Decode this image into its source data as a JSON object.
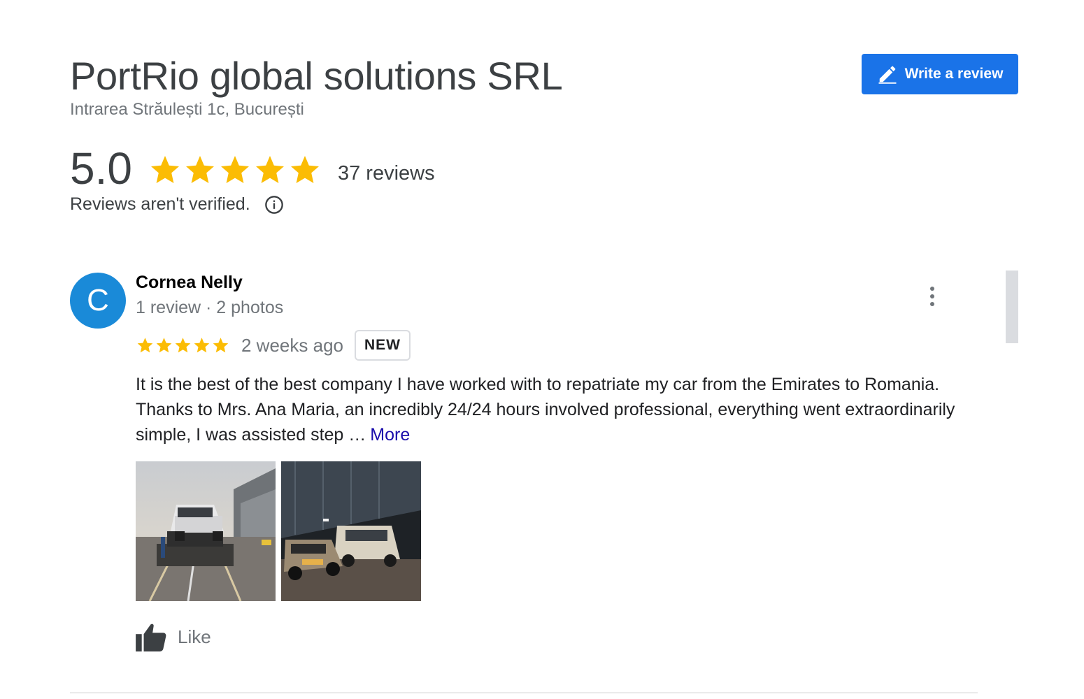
{
  "business": {
    "name": "PortRio global solutions SRL",
    "address": "Intrarea Străulești 1c, București"
  },
  "write_review": {
    "label": "Write a review",
    "icon": "pencil-icon",
    "color": "#1a73e8"
  },
  "rating": {
    "score": "5.0",
    "stars": 5,
    "review_count": "37 reviews",
    "verified_note": "Reviews aren't verified.",
    "star_color": "#fbbc04"
  },
  "review": {
    "avatar_letter": "C",
    "avatar_color": "#1a8ad8",
    "author": "Cornea Nelly",
    "meta": "1 review · 2 photos",
    "stars": 5,
    "time": "2 weeks ago",
    "badge": "NEW",
    "text": "It is the best of the best company I have worked with to repatriate my car from the Emirates to Romania. Thanks to Mrs. Ana Maria, an incredibly 24/24 hours involved professional, everything went extraordinarily simple, I was assisted step …",
    "more_label": "More",
    "photos": [
      {
        "name": "photo-car-on-tow-truck"
      },
      {
        "name": "photo-cars-at-night"
      }
    ],
    "like_label": "Like"
  }
}
